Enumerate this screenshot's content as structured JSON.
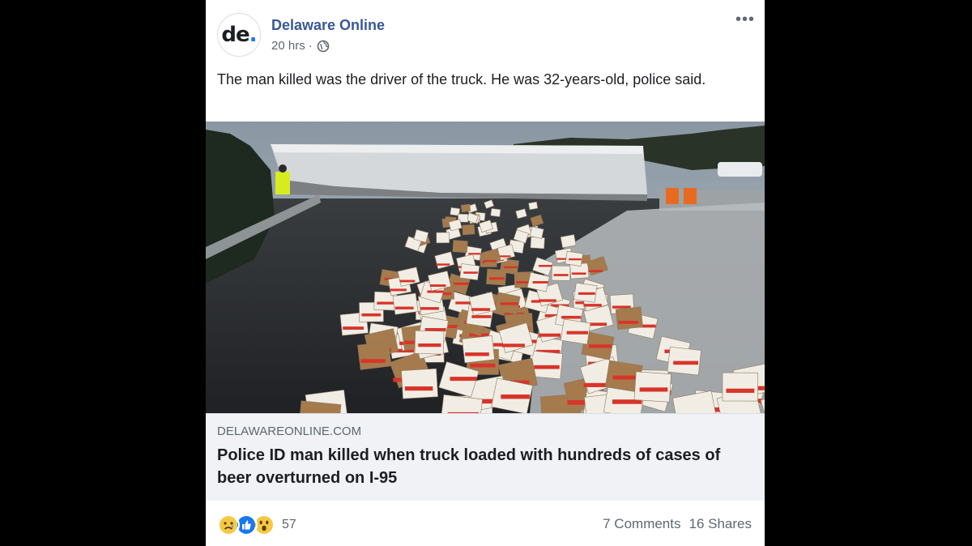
{
  "post": {
    "page_name": "Delaware Online",
    "avatar_text": "de",
    "avatar_dot": ".",
    "time": "20 hrs",
    "separator": "·",
    "privacy_icon": "globe-icon",
    "more_icon": "more-options-icon",
    "more_label": "•••",
    "text": "The man killed was the driver of the truck. He was 32-years-old, police said."
  },
  "link": {
    "domain": "DELAWAREONLINE.COM",
    "headline": "Police ID man killed when truck loaded with hundreds of cases of beer overturned on I-95",
    "image_icon": "accident-photo"
  },
  "footer": {
    "reaction_icons": [
      "sad-icon",
      "like-icon",
      "wow-icon"
    ],
    "reaction_count": "57",
    "comments": "7 Comments",
    "shares": "16 Shares"
  },
  "colors": {
    "link_blue": "#385898",
    "like_blue": "#1877f2",
    "emoji_yellow": "#f7c843"
  }
}
